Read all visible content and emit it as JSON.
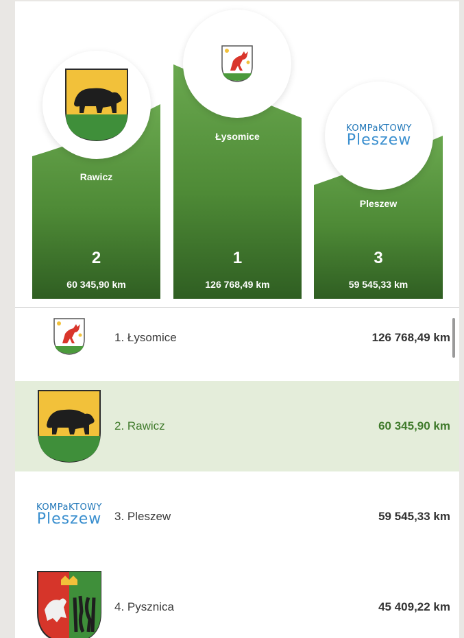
{
  "podium": [
    {
      "place": "2",
      "name": "Rawicz",
      "distance": "60 345,90 km",
      "logo": "bear-coat-of-arms-icon"
    },
    {
      "place": "1",
      "name": "Łysomice",
      "distance": "126 768,49 km",
      "logo": "deer-coat-of-arms-icon"
    },
    {
      "place": "3",
      "name": "Pleszew",
      "distance": "59 545,33 km",
      "logo": "kompaktowy-pleszew-logo"
    }
  ],
  "ranking": [
    {
      "label": "1. Łysomice",
      "distance": "126 768,49 km",
      "logo": "deer-coat-of-arms-icon"
    },
    {
      "label": "2. Rawicz",
      "distance": "60 345,90 km",
      "logo": "bear-coat-of-arms-icon",
      "highlighted": true
    },
    {
      "label": "3. Pleszew",
      "distance": "59 545,33 km",
      "logo": "kompaktowy-pleszew-logo"
    },
    {
      "label": "4. Pysznica",
      "distance": "45 409,22 km",
      "logo": "griffin-tools-coat-of-arms-icon"
    }
  ],
  "wordmark": {
    "line1": "KOMPaKTOWY",
    "line2": "Pleszew"
  },
  "colors": {
    "bar_top": "#6aa84f",
    "bar_bottom": "#2f5e22",
    "highlight_row": "#e4edda",
    "highlight_text": "#3f7a2b",
    "logo_blue": "#1f76b8"
  }
}
